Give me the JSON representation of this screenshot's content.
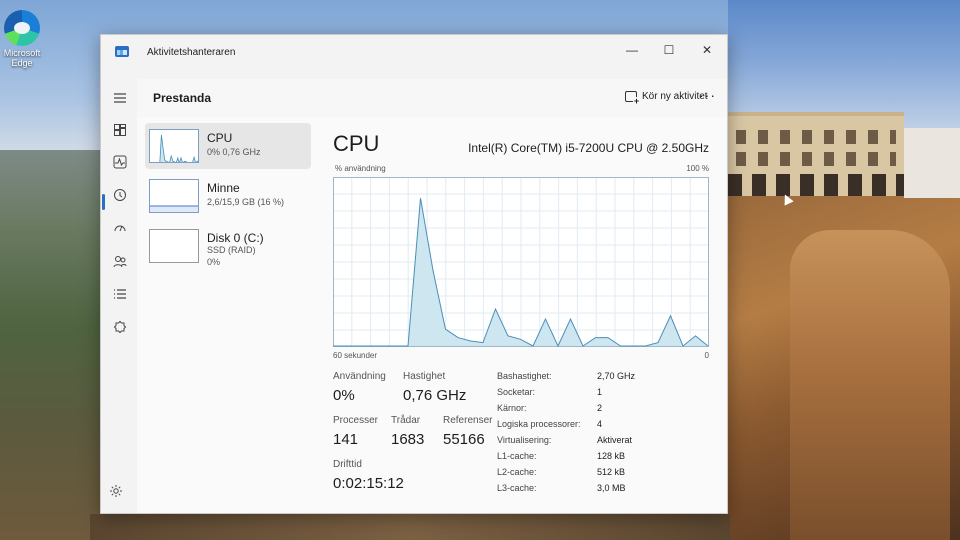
{
  "desktop": {
    "icon_label": "Microsoft Edge"
  },
  "window": {
    "title": "Aktivitetshanteraren",
    "minimize": "—",
    "maximize": "☐",
    "close": "✕"
  },
  "header": {
    "page_title": "Prestanda",
    "run_task_label": "Kör ny aktivitet",
    "more": "···"
  },
  "nav": {
    "items": [
      "menu",
      "processes",
      "performance",
      "app-history",
      "startup",
      "users",
      "details",
      "services"
    ]
  },
  "perf_items": [
    {
      "name": "CPU",
      "sub1": "0% 0,76 GHz",
      "sub2": ""
    },
    {
      "name": "Minne",
      "sub1": "2,6/15,9 GB (16 %)",
      "sub2": ""
    },
    {
      "name": "Disk 0 (C:)",
      "sub1": "SSD (RAID)",
      "sub2": "0%"
    }
  ],
  "detail": {
    "title": "CPU",
    "model": "Intel(R) Core(TM) i5-7200U CPU @ 2.50GHz",
    "axis_top_left": "% användning",
    "axis_top_right": "100 %",
    "axis_bottom_left": "60 sekunder",
    "axis_bottom_right": "0"
  },
  "stats": {
    "usage_label": "Användning",
    "usage_value": "0%",
    "speed_label": "Hastighet",
    "speed_value": "0,76 GHz",
    "processes_label": "Processer",
    "processes_value": "141",
    "threads_label": "Trådar",
    "threads_value": "1683",
    "handles_label": "Referenser",
    "handles_value": "55166",
    "uptime_label": "Drifttid",
    "uptime_value": "0:02:15:12"
  },
  "specs": [
    {
      "key": "Bashastighet:",
      "value": "2,70 GHz"
    },
    {
      "key": "Socketar:",
      "value": "1"
    },
    {
      "key": "Kärnor:",
      "value": "2"
    },
    {
      "key": "Logiska processorer:",
      "value": "4"
    },
    {
      "key": "Virtualisering:",
      "value": "Aktiverat"
    },
    {
      "key": "L1-cache:",
      "value": "128 kB"
    },
    {
      "key": "L2-cache:",
      "value": "512 kB"
    },
    {
      "key": "L3-cache:",
      "value": "3,0 MB"
    }
  ],
  "colors": {
    "accent": "#2a6fc4",
    "graph_line": "#4a8fb8",
    "graph_fill": "#cde6ef",
    "graph_grid": "#e1ebf2",
    "memory_line": "#6b8fd0"
  },
  "chart_data": {
    "type": "area",
    "xlabel": "60 sekunder",
    "ylabel": "% användning",
    "ylim": [
      0,
      100
    ],
    "x": [
      60,
      58,
      56,
      54,
      52,
      50,
      48,
      46,
      44,
      42,
      40,
      38,
      36,
      34,
      32,
      30,
      28,
      26,
      24,
      22,
      20,
      18,
      16,
      14,
      12,
      10,
      8,
      6,
      4,
      2,
      0
    ],
    "series": [
      {
        "values": [
          0,
          0,
          0,
          0,
          0,
          0,
          0,
          88,
          45,
          10,
          5,
          3,
          2,
          22,
          6,
          4,
          0,
          16,
          0,
          16,
          0,
          5,
          5,
          0,
          0,
          0,
          2,
          18,
          0,
          6,
          0
        ]
      }
    ]
  }
}
